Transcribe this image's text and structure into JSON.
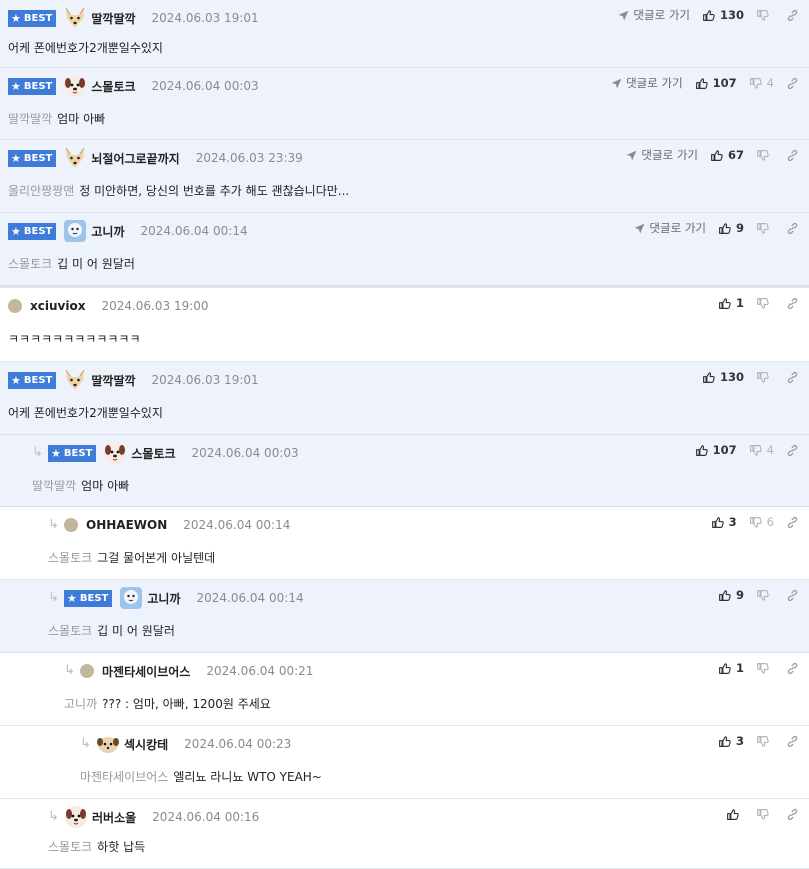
{
  "best_label": "BEST",
  "reply_label": "댓글로 가기",
  "colors": {
    "accent": "#3f7bd8",
    "best_bg": "#eef3fb"
  },
  "comments": [
    {
      "best": true,
      "avatar": "dog",
      "nick": "딸깍딸깍",
      "date": "2024.06.03 19:01",
      "ref": "",
      "text": "어케 폰에번호가2개뿐일수있지",
      "likes": "130",
      "dislikes": "",
      "reply_link": true
    },
    {
      "best": true,
      "avatar": "puppy",
      "nick": "스몰토크",
      "date": "2024.06.04 00:03",
      "ref": "딸깍딸깍",
      "text": "엄마 아빠",
      "likes": "107",
      "dislikes": "4",
      "reply_link": true
    },
    {
      "best": true,
      "avatar": "dog",
      "nick": "뇌절어그로끝까지",
      "date": "2024.06.03 23:39",
      "ref": "올리안짱짱맨",
      "text": "정 미안하면, 당신의 번호를 추가 해도 괜찮습니다만...",
      "likes": "67",
      "dislikes": "",
      "reply_link": true
    },
    {
      "best": true,
      "avatar": "blue",
      "nick": "고니까",
      "date": "2024.06.04 00:14",
      "ref": "스몰토크",
      "text": "깁 미 어 원달러",
      "likes": "9",
      "dislikes": "",
      "reply_link": true
    },
    {
      "best": false,
      "avatar": "dot",
      "nick": "xciuviox",
      "date": "2024.06.03 19:00",
      "ref": "",
      "text": "ㅋㅋㅋㅋㅋㅋㅋㅋㅋㅋㅋㅋ",
      "likes": "1",
      "dislikes": ""
    },
    {
      "best": true,
      "avatar": "dog",
      "nick": "딸깍딸깍",
      "date": "2024.06.03 19:01",
      "ref": "",
      "text": "어케 폰에번호가2개뿐일수있지",
      "likes": "130",
      "dislikes": ""
    },
    {
      "best": true,
      "avatar": "puppy",
      "nick": "스몰토크",
      "date": "2024.06.04 00:03",
      "ref": "딸깍딸깍",
      "text": "엄마 아빠",
      "likes": "107",
      "dislikes": "4"
    },
    {
      "best": false,
      "avatar": "dot",
      "nick": "OHHAEWON",
      "date": "2024.06.04 00:14",
      "ref": "스몰토크",
      "text": "그걸 물어본게 아닐텐데",
      "likes": "3",
      "dislikes": "6"
    },
    {
      "best": true,
      "avatar": "blue",
      "nick": "고니까",
      "date": "2024.06.04 00:14",
      "ref": "스몰토크",
      "text": "깁 미 어 원달러",
      "likes": "9",
      "dislikes": ""
    },
    {
      "best": false,
      "avatar": "dot",
      "nick": "마젠타세이브어스",
      "date": "2024.06.04 00:21",
      "ref": "고니까",
      "text": "??? : 엄마, 아빠, 1200원 주세요",
      "likes": "1",
      "dislikes": ""
    },
    {
      "best": false,
      "avatar": "small",
      "nick": "섹시캉테",
      "date": "2024.06.04 00:23",
      "ref": "마젠타세이브어스",
      "text": "엘리뇨 라니뇨 WTO YEAH~",
      "likes": "3",
      "dislikes": ""
    },
    {
      "best": false,
      "avatar": "puppy",
      "nick": "러버소울",
      "date": "2024.06.04 00:16",
      "ref": "스몰토크",
      "text": "하핫 납득",
      "likes": "",
      "dislikes": ""
    }
  ]
}
